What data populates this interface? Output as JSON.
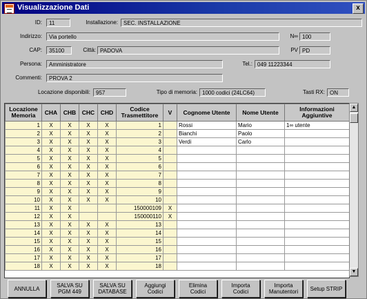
{
  "window": {
    "title": "Visualizzazione Dati",
    "close_label": "x"
  },
  "form": {
    "id_label": "ID:",
    "id_value": "11",
    "installazione_label": "Installazione:",
    "installazione_value": "SEC. INSTALLAZIONE",
    "indirizzo_label": "Indirizzo:",
    "indirizzo_value": "Via portello",
    "n_label": "N∞",
    "n_value": "100",
    "cap_label": "CAP:",
    "cap_value": "35100",
    "citta_label": "Città:",
    "citta_value": "PADOVA",
    "pv_label": "PV",
    "pv_value": "PD",
    "persona_label": "Persona:",
    "persona_value": "Amministratore",
    "tel_label": "Tel.:",
    "tel_value": "049 11223344",
    "commenti_label": "Commenti:",
    "commenti_value": "PROVA 2",
    "locazione_label": "Locazione disponibili:",
    "locazione_value": "957",
    "memoria_label": "Tipo di memoria:",
    "memoria_value": "1000 codici (24LC64)",
    "tasti_label": "Tasti RX:",
    "tasti_value": "ON"
  },
  "table": {
    "headers": [
      "Locazione\nMemoria",
      "CHA",
      "CHB",
      "CHC",
      "CHD",
      "Codice\nTrasmettitore",
      "V",
      "Cognome Utente",
      "Nome Utente",
      "Informazioni\nAggiuntive"
    ],
    "rows": [
      [
        "1",
        "X",
        "X",
        "X",
        "X",
        "1",
        "",
        "Rossi",
        "Mario",
        "1∞ utente"
      ],
      [
        "2",
        "X",
        "X",
        "X",
        "X",
        "2",
        "",
        "Bianchi",
        "Paolo",
        ""
      ],
      [
        "3",
        "X",
        "X",
        "X",
        "X",
        "3",
        "",
        "Verdi",
        "Carlo",
        ""
      ],
      [
        "4",
        "X",
        "X",
        "X",
        "X",
        "4",
        "",
        "",
        "",
        ""
      ],
      [
        "5",
        "X",
        "X",
        "X",
        "X",
        "5",
        "",
        "",
        "",
        ""
      ],
      [
        "6",
        "X",
        "X",
        "X",
        "X",
        "6",
        "",
        "",
        "",
        ""
      ],
      [
        "7",
        "X",
        "X",
        "X",
        "X",
        "7",
        "",
        "",
        "",
        ""
      ],
      [
        "8",
        "X",
        "X",
        "X",
        "X",
        "8",
        "",
        "",
        "",
        ""
      ],
      [
        "9",
        "X",
        "X",
        "X",
        "X",
        "9",
        "",
        "",
        "",
        ""
      ],
      [
        "10",
        "X",
        "X",
        "X",
        "X",
        "10",
        "",
        "",
        "",
        ""
      ],
      [
        "11",
        "X",
        "X",
        "",
        "",
        "150000109",
        "X",
        "",
        "",
        ""
      ],
      [
        "12",
        "X",
        "X",
        "",
        "",
        "150000110",
        "X",
        "",
        "",
        ""
      ],
      [
        "13",
        "X",
        "X",
        "X",
        "X",
        "13",
        "",
        "",
        "",
        ""
      ],
      [
        "14",
        "X",
        "X",
        "X",
        "X",
        "14",
        "",
        "",
        "",
        ""
      ],
      [
        "15",
        "X",
        "X",
        "X",
        "X",
        "15",
        "",
        "",
        "",
        ""
      ],
      [
        "16",
        "X",
        "X",
        "X",
        "X",
        "16",
        "",
        "",
        "",
        ""
      ],
      [
        "17",
        "X",
        "X",
        "X",
        "X",
        "17",
        "",
        "",
        "",
        ""
      ],
      [
        "18",
        "X",
        "X",
        "X",
        "X",
        "18",
        "",
        "",
        "",
        ""
      ]
    ]
  },
  "buttons": [
    {
      "line1": "ANNULLA",
      "line2": ""
    },
    {
      "line1": "SALVA SU",
      "line2": "PGM 449"
    },
    {
      "line1": "SALVA SU",
      "line2": "DATABASE"
    },
    {
      "line1": "Aggiungi",
      "line2": "Codici"
    },
    {
      "line1": "Elimina",
      "line2": "Codici"
    },
    {
      "line1": "Importa",
      "line2": "Codici"
    },
    {
      "line1": "Importa",
      "line2": "Manutentori"
    },
    {
      "line1": "Setup STRIP",
      "line2": ""
    }
  ],
  "colors": {
    "titlebar": "#000080",
    "row_highlight": "#fbf6cf",
    "window_bg": "#c3c3c3"
  }
}
